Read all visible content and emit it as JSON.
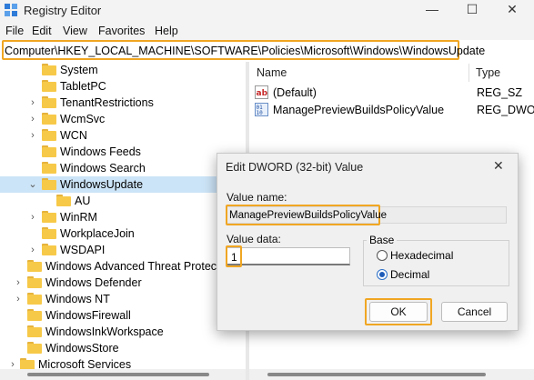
{
  "window": {
    "title": "Registry Editor",
    "controls": {
      "minimize": "—",
      "maximize": "☐",
      "close": "✕"
    }
  },
  "menu": [
    "File",
    "Edit",
    "View",
    "Favorites",
    "Help"
  ],
  "address": "Computer\\HKEY_LOCAL_MACHINE\\SOFTWARE\\Policies\\Microsoft\\Windows\\WindowsUpdate",
  "tree": [
    {
      "label": "System",
      "depth": 2,
      "expandable": false,
      "expanded": false,
      "selected": false
    },
    {
      "label": "TabletPC",
      "depth": 2,
      "expandable": false,
      "expanded": false,
      "selected": false
    },
    {
      "label": "TenantRestrictions",
      "depth": 2,
      "expandable": true,
      "expanded": false,
      "selected": false
    },
    {
      "label": "WcmSvc",
      "depth": 2,
      "expandable": true,
      "expanded": false,
      "selected": false
    },
    {
      "label": "WCN",
      "depth": 2,
      "expandable": true,
      "expanded": false,
      "selected": false
    },
    {
      "label": "Windows Feeds",
      "depth": 2,
      "expandable": false,
      "expanded": false,
      "selected": false
    },
    {
      "label": "Windows Search",
      "depth": 2,
      "expandable": false,
      "expanded": false,
      "selected": false
    },
    {
      "label": "WindowsUpdate",
      "depth": 2,
      "expandable": true,
      "expanded": true,
      "selected": true
    },
    {
      "label": "AU",
      "depth": 3,
      "expandable": false,
      "expanded": false,
      "selected": false
    },
    {
      "label": "WinRM",
      "depth": 2,
      "expandable": true,
      "expanded": false,
      "selected": false
    },
    {
      "label": "WorkplaceJoin",
      "depth": 2,
      "expandable": false,
      "expanded": false,
      "selected": false
    },
    {
      "label": "WSDAPI",
      "depth": 2,
      "expandable": true,
      "expanded": false,
      "selected": false
    },
    {
      "label": "Windows Advanced Threat Protection",
      "depth": 1,
      "expandable": false,
      "expanded": false,
      "selected": false
    },
    {
      "label": "Windows Defender",
      "depth": 1,
      "expandable": true,
      "expanded": false,
      "selected": false
    },
    {
      "label": "Windows NT",
      "depth": 1,
      "expandable": true,
      "expanded": false,
      "selected": false
    },
    {
      "label": "WindowsFirewall",
      "depth": 1,
      "expandable": false,
      "expanded": false,
      "selected": false
    },
    {
      "label": "WindowsInkWorkspace",
      "depth": 1,
      "expandable": false,
      "expanded": false,
      "selected": false
    },
    {
      "label": "WindowsStore",
      "depth": 1,
      "expandable": false,
      "expanded": false,
      "selected": false
    },
    {
      "label": "Microsoft Services",
      "depth": 0,
      "expandable": true,
      "expanded": false,
      "selected": false
    }
  ],
  "list": {
    "columns": {
      "name": "Name",
      "type": "Type"
    },
    "rows": [
      {
        "name": "(Default)",
        "type": "REG_SZ",
        "icon": "string-value-icon"
      },
      {
        "name": "ManagePreviewBuildsPolicyValue",
        "type": "REG_DWORD",
        "icon": "dword-value-icon"
      }
    ]
  },
  "dialog": {
    "title": "Edit DWORD (32-bit) Value",
    "close": "✕",
    "value_name_label": "Value name:",
    "value_name": "ManagePreviewBuildsPolicyValue",
    "value_data_label": "Value data:",
    "value_data": "1",
    "base_label": "Base",
    "base_options": [
      {
        "label": "Hexadecimal",
        "checked": false
      },
      {
        "label": "Decimal",
        "checked": true
      }
    ],
    "ok": "OK",
    "cancel": "Cancel"
  },
  "colors": {
    "highlight": "#f0a623",
    "selection": "#cce4f7",
    "folder": "#f7c948",
    "dialog_bg": "#f0f0f0"
  }
}
